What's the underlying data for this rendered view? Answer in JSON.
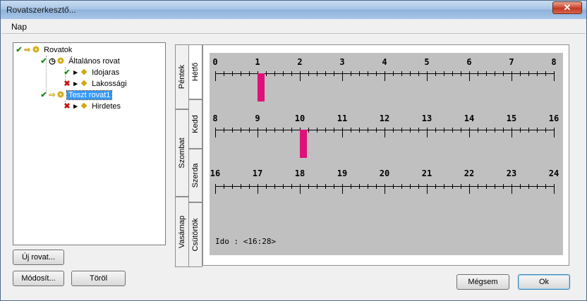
{
  "window": {
    "title": "Rovatszerkesztő...",
    "close_symbol": "✕"
  },
  "menu": {
    "items": [
      {
        "label": "Nap"
      }
    ]
  },
  "tree": {
    "nodes": [
      {
        "id": "rovatok",
        "label": "Rovatok",
        "icons": [
          "ok",
          "arrow",
          "folder"
        ]
      },
      {
        "id": "altalanos",
        "label": "Általános rovat",
        "icons": [
          "ok",
          "clock",
          "folder"
        ]
      },
      {
        "id": "idojaras",
        "label": "Idojaras",
        "icons": [
          "ok",
          "play",
          "doc"
        ]
      },
      {
        "id": "lakossagi",
        "label": "Lakossági",
        "icons": [
          "no",
          "play",
          "doc"
        ]
      },
      {
        "id": "teszt",
        "label": "Teszt rovat1",
        "icons": [
          "ok",
          "arrow",
          "folder"
        ],
        "selected": true
      },
      {
        "id": "hirdetes",
        "label": "Hirdetes",
        "icons": [
          "no",
          "play",
          "doc"
        ]
      }
    ]
  },
  "buttons": {
    "new": "Új rovat...",
    "modify": "Módosít...",
    "delete": "Töröl",
    "cancel": "Mégsem",
    "ok": "Ok"
  },
  "tabs": {
    "outer": [
      "Péntek",
      "Szombat",
      "Vasárnap"
    ],
    "inner": [
      "Hétfő",
      "Kedd",
      "Szerda",
      "Csütörtök"
    ],
    "active": "Hétfő"
  },
  "timeline": {
    "rows": [
      {
        "labels": [
          "0",
          "1",
          "2",
          "3",
          "4",
          "5",
          "6",
          "7",
          "8"
        ],
        "start": 0,
        "end": 8
      },
      {
        "labels": [
          "8",
          "9",
          "10",
          "11",
          "12",
          "13",
          "14",
          "15",
          "16"
        ],
        "start": 8,
        "end": 16
      },
      {
        "labels": [
          "16",
          "17",
          "18",
          "19",
          "20",
          "21",
          "22",
          "23",
          "24"
        ],
        "start": 16,
        "end": 24
      }
    ],
    "marks": [
      {
        "row": 0,
        "hour": 1.0
      },
      {
        "row": 1,
        "hour": 10.0
      }
    ],
    "status": "Ido : <16:28>",
    "mark_color": "#e0107a"
  }
}
